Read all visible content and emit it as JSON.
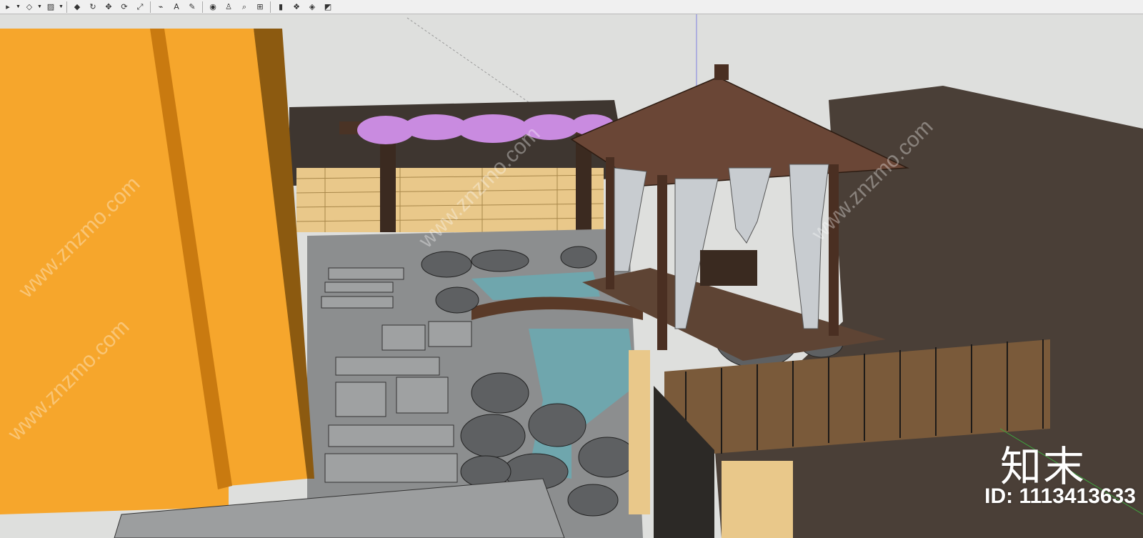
{
  "toolbar": {
    "tools": [
      {
        "icon": "select-arrow-icon",
        "glyph": "▸",
        "dropdown": true
      },
      {
        "icon": "eraser-icon",
        "glyph": "◇",
        "dropdown": true
      },
      {
        "icon": "paint-bucket-icon",
        "glyph": "▨",
        "dropdown": true
      },
      {
        "icon": "push-pull-icon",
        "glyph": "◆"
      },
      {
        "icon": "follow-me-icon",
        "glyph": "↻"
      },
      {
        "icon": "move-icon",
        "glyph": "✥"
      },
      {
        "icon": "rotate-icon",
        "glyph": "⟳"
      },
      {
        "icon": "scale-icon",
        "glyph": "⤢"
      },
      {
        "icon": "tape-measure-icon",
        "glyph": "⌁"
      },
      {
        "icon": "text-icon",
        "glyph": "A"
      },
      {
        "icon": "paint-icon",
        "glyph": "✎"
      },
      {
        "icon": "orbit-icon",
        "glyph": "◉"
      },
      {
        "icon": "walk-icon",
        "glyph": "♙"
      },
      {
        "icon": "zoom-icon",
        "glyph": "⌕"
      },
      {
        "icon": "zoom-extents-icon",
        "glyph": "⊞"
      },
      {
        "icon": "section-plane-icon",
        "glyph": "▮"
      },
      {
        "icon": "components-icon",
        "glyph": "❖"
      },
      {
        "icon": "materials-icon",
        "glyph": "◈"
      },
      {
        "icon": "styles-icon",
        "glyph": "◩"
      }
    ]
  },
  "colors": {
    "sky": "#dedfdd",
    "building_orange": "#f6a62c",
    "building_shadow": "#c97a10",
    "ground_dark": "#4a3f37",
    "wall_brown": "#3e2f24",
    "bamboo_fence": "#e9c88a",
    "water": "#6fa6ad",
    "stone_grey": "#6b6d6f",
    "paving": "#8c8e8f",
    "pavilion_roof": "#5c3a2b",
    "flowers": "#c98be0"
  },
  "watermark": {
    "logo": "知末",
    "id": "ID: 1113413633",
    "diagonal_text": "www.znzmo.com"
  }
}
